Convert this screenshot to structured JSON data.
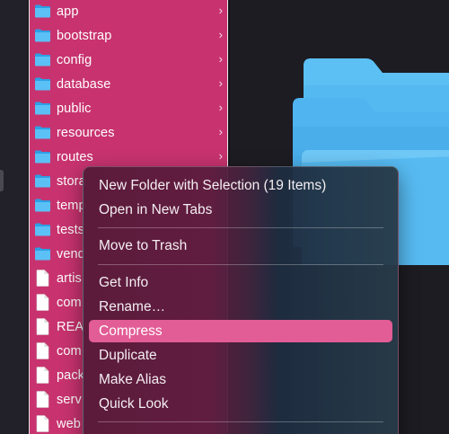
{
  "file_list": {
    "items": [
      {
        "name": "app",
        "type": "folder",
        "chevron": true
      },
      {
        "name": "bootstrap",
        "type": "folder",
        "chevron": true
      },
      {
        "name": "config",
        "type": "folder",
        "chevron": true
      },
      {
        "name": "database",
        "type": "folder",
        "chevron": true
      },
      {
        "name": "public",
        "type": "folder",
        "chevron": true
      },
      {
        "name": "resources",
        "type": "folder",
        "chevron": true
      },
      {
        "name": "routes",
        "type": "folder",
        "chevron": true
      },
      {
        "name": "stora",
        "type": "folder",
        "chevron": false
      },
      {
        "name": "temp",
        "type": "folder",
        "chevron": false
      },
      {
        "name": "tests",
        "type": "folder",
        "chevron": false
      },
      {
        "name": "vend",
        "type": "folder",
        "chevron": false
      },
      {
        "name": "artis",
        "type": "file",
        "chevron": false
      },
      {
        "name": "com",
        "type": "file",
        "chevron": false
      },
      {
        "name": "REA",
        "type": "file",
        "chevron": false
      },
      {
        "name": "com",
        "type": "file",
        "chevron": false
      },
      {
        "name": "pack",
        "type": "file",
        "chevron": false
      },
      {
        "name": "serv",
        "type": "file",
        "chevron": false
      },
      {
        "name": "web",
        "type": "file",
        "chevron": false
      }
    ],
    "chevron_glyph": "›"
  },
  "context_menu": {
    "groups": [
      [
        "New Folder with Selection (19 Items)",
        "Open in New Tabs"
      ],
      [
        "Move to Trash"
      ],
      [
        "Get Info",
        "Rename…",
        "Compress",
        "Duplicate",
        "Make Alias",
        "Quick Look"
      ]
    ],
    "highlighted": "Compress"
  },
  "colors": {
    "selection": "#c8336f",
    "menu_highlight": "#e25c95",
    "folder_blue": "#4bb3ef",
    "background": "#1d1c22"
  },
  "icons": {
    "folder": "folder-icon",
    "file": "document-icon",
    "preview": "folder-preview-icon"
  }
}
